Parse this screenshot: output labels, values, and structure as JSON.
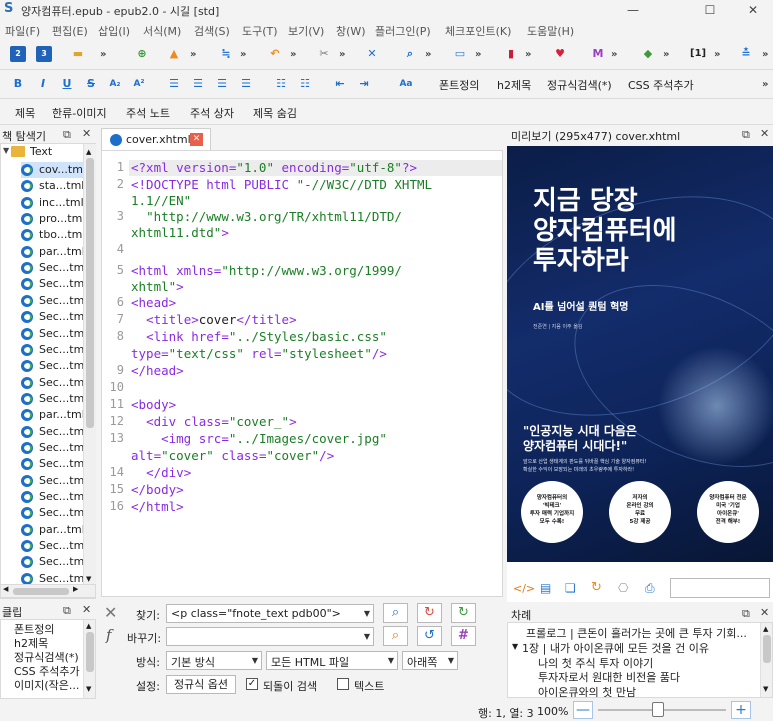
{
  "window": {
    "title": "양자컴퓨터.epub - epub2.0 - 시길 [std]",
    "minimize": "—",
    "maximize": "☐",
    "close": "✕"
  },
  "menu": [
    "파일(F)",
    "편집(E)",
    "삽입(I)",
    "서식(M)",
    "검색(S)",
    "도구(T)",
    "보기(V)",
    "창(W)",
    "플러그인(P)",
    "체크포인트(K)",
    "도움말(H)"
  ],
  "toolbar3": {
    "items": [
      "폰트정의",
      "h2제목",
      "정규식검색(*)",
      "CSS 주석추가"
    ]
  },
  "toolbar4": {
    "items": [
      "제목",
      "한류-이미지",
      "주석 노트",
      "주석 상자",
      "제목 숨김"
    ]
  },
  "book_browser": {
    "title": "책 탐색기",
    "folder": "Text",
    "files": [
      "cov...tml",
      "sta...tml",
      "inc...tml",
      "pro...tml",
      "tbo...tml",
      "par...tml",
      "Sec...tml",
      "Sec...tml",
      "Sec...tml",
      "Sec...tml",
      "Sec...tml",
      "Sec...tml",
      "Sec...tml",
      "Sec...tml",
      "Sec...tml",
      "par...tml",
      "Sec...tml",
      "Sec...tml",
      "Sec...tml",
      "Sec...tml",
      "Sec...tml",
      "Sec...tml",
      "par...tml",
      "Sec...tml",
      "Sec...tml",
      "Sec...tml"
    ]
  },
  "editor": {
    "tab": "cover.xhtml",
    "line_numbers": [
      "1",
      "2",
      "",
      "3",
      "",
      "4",
      "5",
      "",
      "6",
      "7",
      "8",
      "",
      "9",
      "10",
      "11",
      "12",
      "13",
      "",
      "14",
      "15",
      "16"
    ]
  },
  "clips": {
    "title": "클립",
    "items": [
      "폰트정의",
      "h2제목",
      "정규식검색(*)",
      "CSS 주석추가",
      "이미지(작은..."
    ]
  },
  "find": {
    "find_label": "찾기:",
    "find_value": "<p class=\"fnote_text pdb00\">",
    "replace_label": "바꾸기:",
    "replace_value": "",
    "mode_label": "방식:",
    "mode_value": "기본 방식",
    "scope_value": "모든 HTML 파일",
    "direction_value": "아래쪽",
    "settings_label": "설정:",
    "options_button": "정규식 옵션",
    "wrap_label": "되돌이 검색",
    "text_label": "텍스트"
  },
  "preview": {
    "title": "미리보기 (295x477) cover.xhtml",
    "cover_title": "지금 당장\n양자컴퓨터에\n투자하라",
    "cover_subtitle": "AI를 넘어설 퀀텀 혁명",
    "cover_author": "전준연 | 지음 이주 옮김",
    "cover_quote": "\"인공지능 시대 다음은\n양자컴퓨터 시대다!\"",
    "cover_blurb": "앞으로 산업 생태계의 판도를 뒤바꿀 핵심 기술 양자컴퓨터!\n확실한 수익이 보장되는 미래의 초우량주에 투자하라!",
    "badge1": "양자컴퓨터의\n'빅테크'\n투자 매력 기업까지\n모두 수록!",
    "badge2": "저자의\n온라인 강의\n무료\n5강 제공",
    "badge3": "양자컴퓨터 전문\n미국 '기업\n아이온큐'\n전격 해부!"
  },
  "toc": {
    "title": "차례",
    "items": [
      "프롤로그 | 큰돈이 흘러가는 곳에 큰 투자 기회...",
      "1장 | 내가 아이온큐에 모든 것을 건 이유",
      "나의 첫 주식 투자 이야기",
      "투자자로서 원대한 비전을 품다",
      "아이온큐와의 첫 만남"
    ]
  },
  "status": {
    "position": "행: 1, 열: 3",
    "zoom": "100%"
  },
  "colors": {
    "accent": "#2c6fb5",
    "tag": "#8a2be2",
    "string": "#1a7f24"
  }
}
